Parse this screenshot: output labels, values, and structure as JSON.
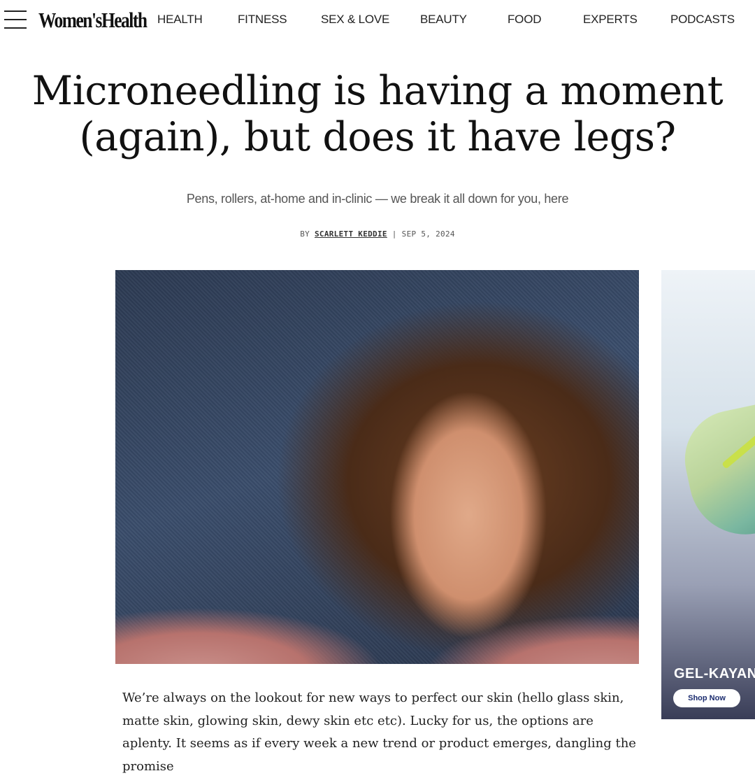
{
  "header": {
    "logo": "Women'sHealth",
    "nav": [
      "HEALTH",
      "FITNESS",
      "SEX & LOVE",
      "BEAUTY",
      "FOOD",
      "EXPERTS",
      "PODCASTS"
    ]
  },
  "article": {
    "headline_line1": "Microneedling is having a moment",
    "headline_line2": "(again), but does it have legs?",
    "dek": "Pens, rollers, at-home and in-clinic — we break it all down for you, here",
    "byline_prefix": "BY",
    "author": "SCARLETT KEDDIE",
    "byline_separator": "|",
    "date": "SEP 5, 2024",
    "body": "We’re always on the lookout for new ways to perfect our skin (hello glass skin, matte skin, glowing skin, dewy skin etc etc). Lucky for us, the options are aplenty. It seems as if every week a new trend or product emerges, dangling the promise"
  },
  "ad": {
    "title": "GEL-KAYAN",
    "button": "Shop Now"
  }
}
